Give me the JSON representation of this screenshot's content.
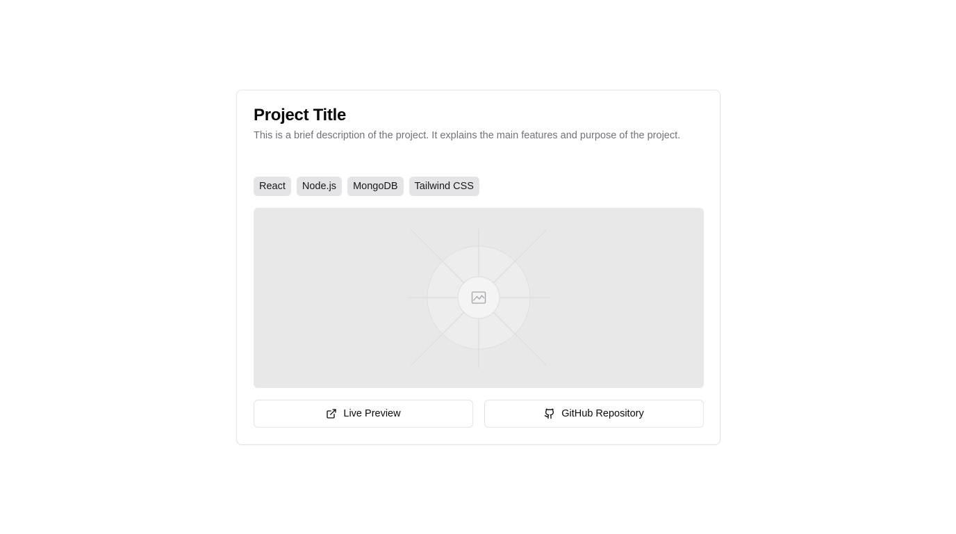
{
  "project": {
    "title": "Project Title",
    "description": "This is a brief description of the project. It explains the main features and purpose of the project."
  },
  "tags": [
    "React",
    "Node.js",
    "MongoDB",
    "Tailwind CSS"
  ],
  "preview": {
    "icon": "image-icon"
  },
  "actions": {
    "live_preview_label": "Live Preview",
    "live_preview_icon": "external-link-icon",
    "github_label": "GitHub Repository",
    "github_icon": "github-icon"
  },
  "colors": {
    "tag_bg": "#e4e4e7",
    "preview_bg": "#e8e8e8",
    "muted_text": "#71717a",
    "border": "#e4e4e7"
  }
}
